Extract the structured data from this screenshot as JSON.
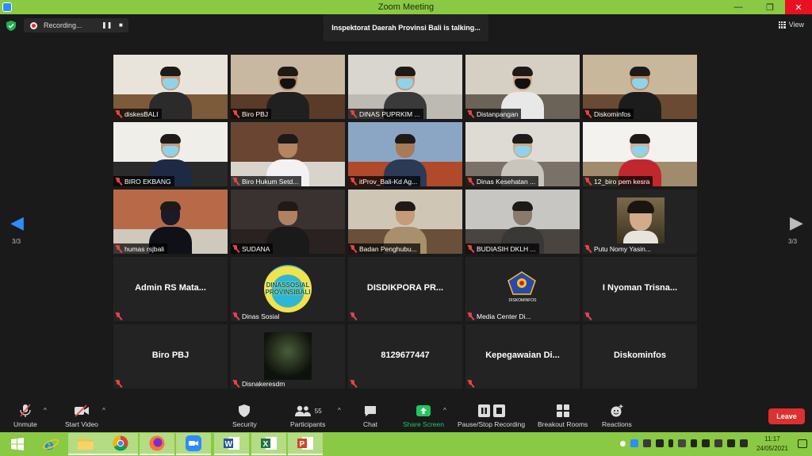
{
  "window": {
    "title": "Zoom Meeting",
    "minimize": "—",
    "maximize": "❐",
    "close": "✕"
  },
  "meeting": {
    "recording_label": "Recording...",
    "talking_banner": "Inspektorat Daerah Provinsi Bali is talking...",
    "view_label": "View",
    "page_left": "3/3",
    "page_right": "3/3"
  },
  "participants": [
    {
      "name": "diskesBALI",
      "kind": "video",
      "wall": "#e8e4dc",
      "floor": "#7b5b3a",
      "mask": "blue",
      "body": "#2b2b2b",
      "skin": "#c99b76"
    },
    {
      "name": "Biro PBJ",
      "kind": "video",
      "wall": "#c8b8a2",
      "floor": "#5a3a28",
      "mask": "black",
      "body": "#202020",
      "skin": "#b98a66"
    },
    {
      "name": "DINAS PUPRKIM ...",
      "kind": "video",
      "wall": "#d9d6d0",
      "floor": "#bdbab4",
      "mask": "blue",
      "body": "#3a3a3a",
      "skin": "#c49a7a"
    },
    {
      "name": "Distanpangan",
      "kind": "video",
      "wall": "#d6d0c4",
      "floor": "#6b6258",
      "mask": "black",
      "body": "#e8e8e8",
      "skin": "#d0a888"
    },
    {
      "name": "Diskominfos",
      "kind": "video",
      "wall": "#c9b79c",
      "floor": "#6a4a33",
      "mask": "blue",
      "body": "#1c1c1c",
      "skin": "#b88a62"
    },
    {
      "name": "BIRO EKBANG",
      "kind": "video",
      "wall": "#f0eee8",
      "floor": "#2a2a2a",
      "mask": "blue",
      "body": "#1e2a44",
      "skin": "#c69a78"
    },
    {
      "name": "Biro Hukum Setd...",
      "kind": "video",
      "wall": "#6a4632",
      "floor": "#d8d4cc",
      "mask": "none",
      "body": "#f2f2f2",
      "skin": "#b38560"
    },
    {
      "name": "itProv_Bali-Kd Ag...",
      "kind": "video",
      "wall": "#8aa6c4",
      "floor": "#b04a2a",
      "mask": "none",
      "body": "#2c3a55",
      "skin": "#a87a58"
    },
    {
      "name": "Dinas Kesehatan ...",
      "kind": "video",
      "wall": "#dedad4",
      "floor": "#7a7268",
      "mask": "blue",
      "body": "#c9c4bc",
      "skin": "#cfa98a"
    },
    {
      "name": "12_biro pem kesra",
      "kind": "video",
      "wall": "#f4f2ee",
      "floor": "#a08c6c",
      "mask": "blue",
      "body": "#c0282e",
      "skin": "#d4ae90"
    },
    {
      "name": "humas rsjbali",
      "kind": "video",
      "wall": "#b86a48",
      "floor": "#cfc8bc",
      "mask": "none",
      "body": "#101018",
      "skin": "#1a1a2a"
    },
    {
      "name": "SUDANA",
      "kind": "video",
      "wall": "#3a3230",
      "floor": "#2a2220",
      "mask": "none",
      "body": "#1a1a1a",
      "skin": "#b08260"
    },
    {
      "name": "Badan Penghubu...",
      "kind": "video",
      "wall": "#cfc6b6",
      "floor": "#6a5038",
      "mask": "none",
      "body": "#a8906c",
      "skin": "#c69c78"
    },
    {
      "name": "BUDIASIH DKLH ...",
      "kind": "video",
      "wall": "#c8c6c2",
      "floor": "#4a4440",
      "mask": "none",
      "body": "#3a3836",
      "skin": "#8a7a6a"
    },
    {
      "name": "Putu Nomy Yasin...",
      "kind": "photo-woman"
    },
    {
      "name": "Admin RS Mata...",
      "kind": "name"
    },
    {
      "name": "Dinas Sosial",
      "kind": "logo-sosial",
      "logo_line1": "DINASSOSIAL",
      "logo_line2": "PROVINSIBALI"
    },
    {
      "name": "DISDIKPORA PR...",
      "kind": "name"
    },
    {
      "name": "Media Center Di...",
      "kind": "logo-kominfo",
      "logo_text": "DISKOMINFOS"
    },
    {
      "name": "I Nyoman Trisna...",
      "kind": "name"
    },
    {
      "name": "Biro PBJ",
      "kind": "name"
    },
    {
      "name": "Disnakeresdm",
      "kind": "photo-night"
    },
    {
      "name": "8129677447",
      "kind": "name"
    },
    {
      "name": "Kepegawaian Di...",
      "kind": "name"
    },
    {
      "name": "Diskominfos",
      "kind": "name-nomic"
    }
  ],
  "toolbar": {
    "unmute": "Unmute",
    "start_video": "Start Video",
    "security": "Security",
    "participants": "Participants",
    "participants_count": "55",
    "chat": "Chat",
    "share_screen": "Share Screen",
    "recording": "Pause/Stop Recording",
    "breakout": "Breakout Rooms",
    "reactions": "Reactions",
    "leave": "Leave"
  },
  "taskbar": {
    "time": "11:17",
    "date": "24/05/2021"
  },
  "colors": {
    "accent": "#2d8cff",
    "titlebar": "#8ac943",
    "leave": "#e02f2f",
    "share_green": "#22c55e",
    "muted_red": "#e34545"
  }
}
